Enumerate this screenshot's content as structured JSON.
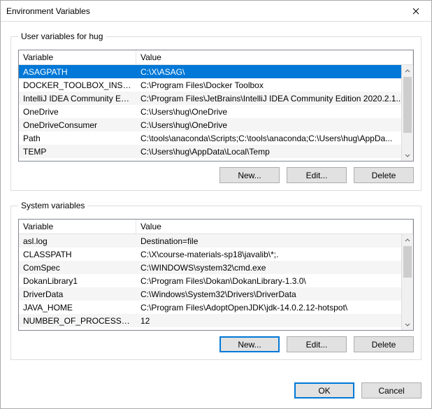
{
  "title": "Environment Variables",
  "group_user": {
    "legend": "User variables for hug"
  },
  "group_sys": {
    "legend": "System variables"
  },
  "columns": {
    "var": "Variable",
    "val": "Value"
  },
  "user_vars": [
    {
      "name": "ASAGPATH",
      "value": "C:\\X\\ASAG\\",
      "selected": true
    },
    {
      "name": "DOCKER_TOOLBOX_INSTALL...",
      "value": "C:\\Program Files\\Docker Toolbox"
    },
    {
      "name": "IntelliJ IDEA Community Edit...",
      "value": "C:\\Program Files\\JetBrains\\IntelliJ IDEA Community Edition 2020.2.1..."
    },
    {
      "name": "OneDrive",
      "value": "C:\\Users\\hug\\OneDrive"
    },
    {
      "name": "OneDriveConsumer",
      "value": "C:\\Users\\hug\\OneDrive"
    },
    {
      "name": "Path",
      "value": "C:\\tools\\anaconda\\Scripts;C:\\tools\\anaconda;C:\\Users\\hug\\AppDa..."
    },
    {
      "name": "TEMP",
      "value": "C:\\Users\\hug\\AppData\\Local\\Temp"
    }
  ],
  "sys_vars": [
    {
      "name": "asl.log",
      "value": "Destination=file"
    },
    {
      "name": "CLASSPATH",
      "value": "C:\\X\\course-materials-sp18\\javalib\\*;."
    },
    {
      "name": "ComSpec",
      "value": "C:\\WINDOWS\\system32\\cmd.exe"
    },
    {
      "name": "DokanLibrary1",
      "value": "C:\\Program Files\\Dokan\\DokanLibrary-1.3.0\\"
    },
    {
      "name": "DriverData",
      "value": "C:\\Windows\\System32\\Drivers\\DriverData"
    },
    {
      "name": "JAVA_HOME",
      "value": "C:\\Program Files\\AdoptOpenJDK\\jdk-14.0.2.12-hotspot\\"
    },
    {
      "name": "NUMBER_OF_PROCESSORS",
      "value": "12"
    }
  ],
  "buttons": {
    "new": "New...",
    "edit": "Edit...",
    "delete": "Delete",
    "ok": "OK",
    "cancel": "Cancel"
  }
}
